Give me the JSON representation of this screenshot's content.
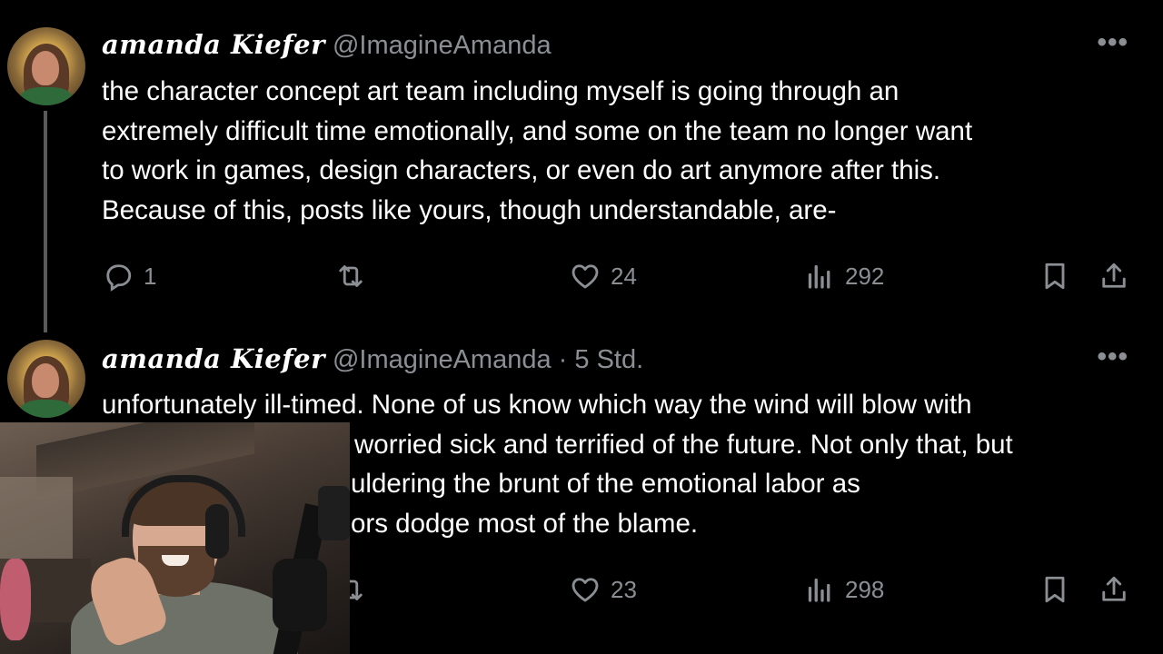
{
  "tweets": [
    {
      "author_name": "amanda Kiefer",
      "handle": "@ImagineAmanda",
      "separator": "",
      "time": "",
      "more_label": "•••",
      "lines": [
        "the character concept art team including myself is going through an",
        "extremely difficult time emotionally, and some on the team no longer want",
        "to work in games, design characters, or even do art anymore after this.",
        "Because of this, posts like yours, though understandable, are-"
      ],
      "actions": {
        "replies": "1",
        "reposts": "",
        "likes": "24",
        "views": "292"
      }
    },
    {
      "author_name": "amanda Kiefer",
      "handle": "@ImagineAmanda",
      "separator": "·",
      "time": "5 Std.",
      "more_label": "•••",
      "lines": [
        "unfortunately ill-timed.  None of us know which way the wind will blow with",
        "worried sick and terrified of the future.  Not only that, but",
        "uldering the brunt of the emotional labor as",
        "ors dodge most of the blame."
      ],
      "actions": {
        "replies": "",
        "reposts": "",
        "likes": "23",
        "views": "298"
      }
    }
  ],
  "colors": {
    "background": "#000000",
    "text": "#ffffff",
    "muted": "#8b8f94"
  },
  "icons": [
    "reply-icon",
    "repost-icon",
    "like-icon",
    "views-icon",
    "bookmark-icon",
    "share-icon",
    "more-icon"
  ]
}
